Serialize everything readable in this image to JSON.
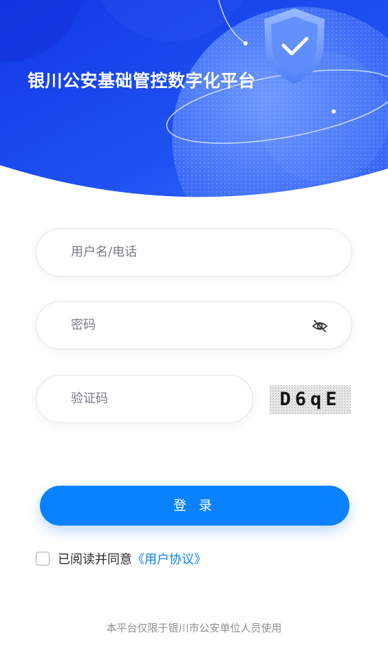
{
  "header": {
    "title": "银川公安基础管控数字化平台"
  },
  "form": {
    "username_placeholder": "用户名/电话",
    "password_placeholder": "密码",
    "captcha_placeholder": "验证码",
    "captcha_code": "D6qE",
    "password_toggle_icon": "eye-off-icon",
    "login_label": "登 录"
  },
  "agreement": {
    "text": "已阅读并同意",
    "link_text": "《用户协议》",
    "checked": false
  },
  "footer": {
    "notice": "本平台仅限于银川市公安单位人员使用"
  },
  "colors": {
    "primary": "#0a82ff",
    "header_blue": "#1a4cf0"
  }
}
